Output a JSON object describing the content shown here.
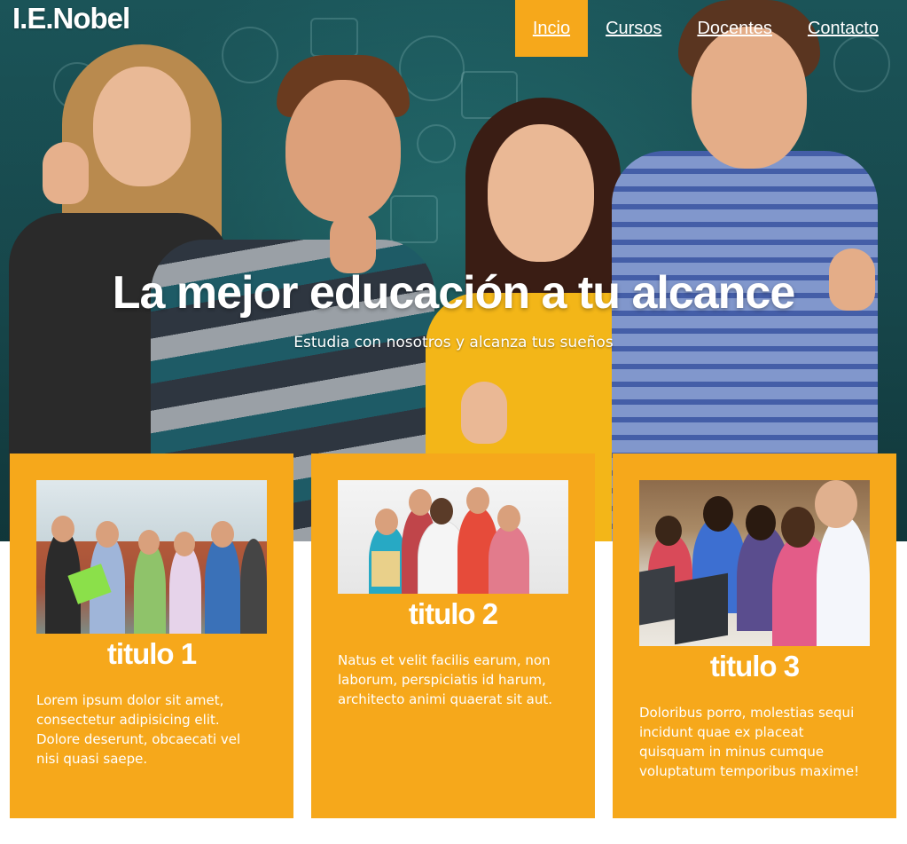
{
  "brand": {
    "logo_text": "I.E.Nobel"
  },
  "nav": {
    "items": [
      {
        "label": "Incio",
        "active": true
      },
      {
        "label": "Cursos",
        "active": false
      },
      {
        "label": "Docentes",
        "active": false
      },
      {
        "label": "Contacto",
        "active": false
      }
    ]
  },
  "hero": {
    "title": "La mejor educación a tu alcance",
    "subtitle": "Estudia con nosotros y alcanza tus sueños"
  },
  "cards": [
    {
      "title": "titulo 1",
      "text": "Lorem ipsum dolor sit amet, consectetur adipisicing elit. Dolore deserunt, obcaecati vel nisi quasi saepe."
    },
    {
      "title": "titulo 2",
      "text": "Natus et velit facilis earum, non laborum, perspiciatis id harum, architecto animi quaerat sit aut."
    },
    {
      "title": "titulo 3",
      "text": "Doloribus porro, molestias sequi incidunt quae ex placeat quisquam in minus cumque voluptatum temporibus maxime!"
    }
  ],
  "colors": {
    "accent": "#f6a81b",
    "hero_bg": "#1f5f63",
    "text_light": "#ffffff"
  }
}
